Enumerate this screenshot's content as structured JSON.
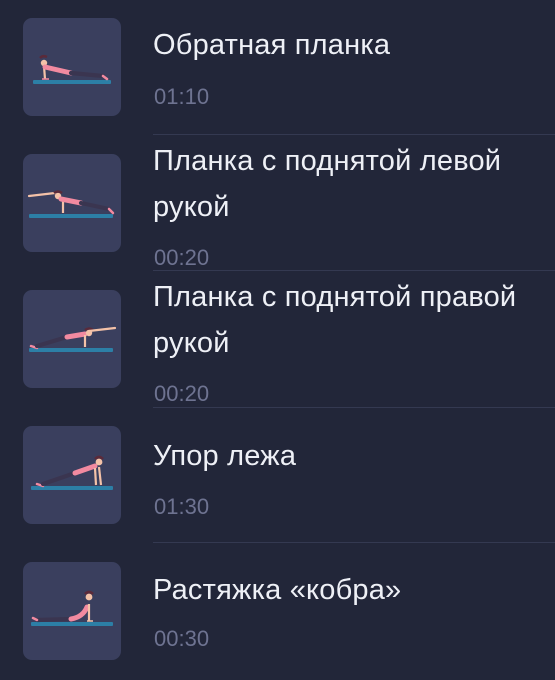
{
  "exercises": [
    {
      "title": "Обратная планка",
      "duration": "01:10",
      "icon": "reverse-plank-icon"
    },
    {
      "title": "Планка с поднятой левой рукой",
      "duration": "00:20",
      "icon": "plank-left-arm-icon"
    },
    {
      "title": "Планка с поднятой правой рукой",
      "duration": "00:20",
      "icon": "plank-right-arm-icon"
    },
    {
      "title": "Упор лежа",
      "duration": "01:30",
      "icon": "push-up-position-icon"
    },
    {
      "title": "Растяжка «кобра»",
      "duration": "00:30",
      "icon": "cobra-stretch-icon"
    }
  ],
  "colors": {
    "background": "#222639",
    "thumbnail": "#3a3f5e",
    "title": "#eef0f6",
    "duration": "#6e7391",
    "mat": "#2c7fa6",
    "accent": "#f28aa0"
  }
}
